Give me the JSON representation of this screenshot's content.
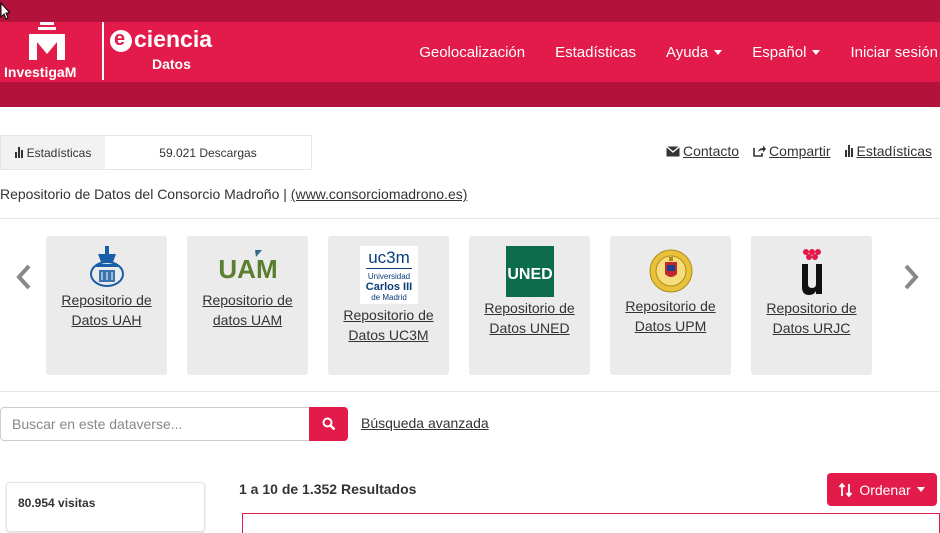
{
  "brand": {
    "investigam": "InvestigaM",
    "eciencia_e": "e",
    "eciencia_title": "ciencia",
    "eciencia_sub": "Datos"
  },
  "nav": {
    "items": [
      {
        "label": "Geolocalización"
      },
      {
        "label": "Estadísticas"
      },
      {
        "label": "Ayuda",
        "dropdown": true
      },
      {
        "label": "Español",
        "dropdown": true
      },
      {
        "label": "Iniciar sesión"
      }
    ]
  },
  "metrics": {
    "label": "Estadísticas",
    "downloads": "59.021 Descargas"
  },
  "actions": {
    "contact": "Contacto",
    "share": "Compartir",
    "stats": "Estadísticas"
  },
  "description": {
    "text": "Repositorio de Datos del Consorcio Madroño | ",
    "url": "(www.consorciomadrono.es)"
  },
  "carousel": {
    "cards": [
      {
        "label": "Repositorio de Datos UAH",
        "logo": "uah-logo"
      },
      {
        "label": "Repositorio de datos UAM",
        "logo": "uam-logo",
        "logo_text": "UAM"
      },
      {
        "label": "Repositorio de Datos UC3M",
        "logo": "uc3m-logo",
        "logo_text": "uc3m",
        "logo_sub1": "Universidad",
        "logo_sub2": "Carlos III",
        "logo_sub3": "de Madrid"
      },
      {
        "label": "Repositorio de Datos UNED",
        "logo": "uned-logo",
        "logo_text": "UNED"
      },
      {
        "label": "Repositorio de Datos UPM",
        "logo": "upm-logo"
      },
      {
        "label": "Repositorio de Datos URJC",
        "logo": "urjc-logo"
      }
    ]
  },
  "search": {
    "placeholder": "Buscar en este dataverse...",
    "advanced": "Búsqueda avanzada"
  },
  "sidebar": {
    "visits": "80.954 visitas"
  },
  "results": {
    "count": "1 a 10 de 1.352 Resultados",
    "sort_label": "Ordenar"
  },
  "colors": {
    "brand": "#e21b4b",
    "brand_dark": "#b3133b",
    "uned_green": "#0b6b4b",
    "uam_green": "#5a7f2e"
  }
}
